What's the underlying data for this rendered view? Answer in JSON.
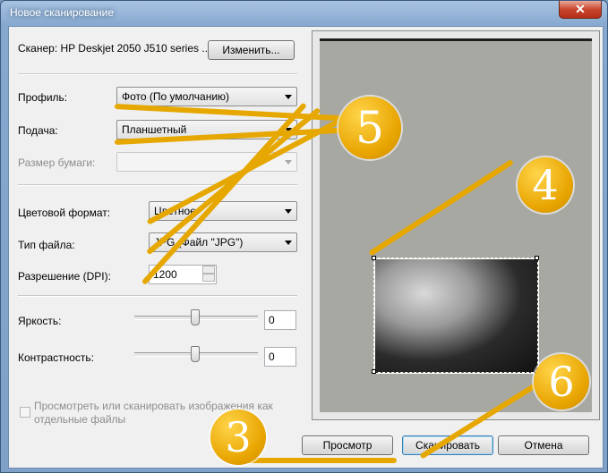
{
  "window": {
    "title": "Новое сканирование",
    "close_glyph": "✕"
  },
  "scanner": {
    "label": "Сканер: HP Deskjet 2050 J510 series ...",
    "change_button": "Изменить..."
  },
  "profile": {
    "label": "Профиль:",
    "value": "Фото (По умолчанию)"
  },
  "source": {
    "label": "Подача:",
    "value": "Планшетный"
  },
  "paper_size": {
    "label": "Размер бумаги:",
    "value": ""
  },
  "color_format": {
    "label": "Цветовой формат:",
    "value": "Цветное"
  },
  "file_type": {
    "label": "Тип файла:",
    "value": "JPG (Файл \"JPG\")"
  },
  "resolution": {
    "label": "Разрешение (DPI):",
    "value": "1200"
  },
  "brightness": {
    "label": "Яркость:",
    "value": "0",
    "level": 0
  },
  "contrast": {
    "label": "Контрастность:",
    "value": "0",
    "level": 0
  },
  "separate_files": {
    "label_line1": "Просмотреть или сканировать изображения как",
    "label_line2": "отдельные файлы",
    "checked": false
  },
  "buttons": {
    "preview": "Просмотр",
    "scan": "Сканировать",
    "cancel": "Отмена"
  },
  "annotations": {
    "badge_3": "3",
    "badge_4": "4",
    "badge_5": "5",
    "badge_6": "6",
    "color": "#e6a800"
  },
  "icons": {
    "close": "close-icon",
    "dropdown": "chevron-down-icon",
    "spin_up": "spin-up-icon",
    "spin_down": "spin-down-icon"
  }
}
